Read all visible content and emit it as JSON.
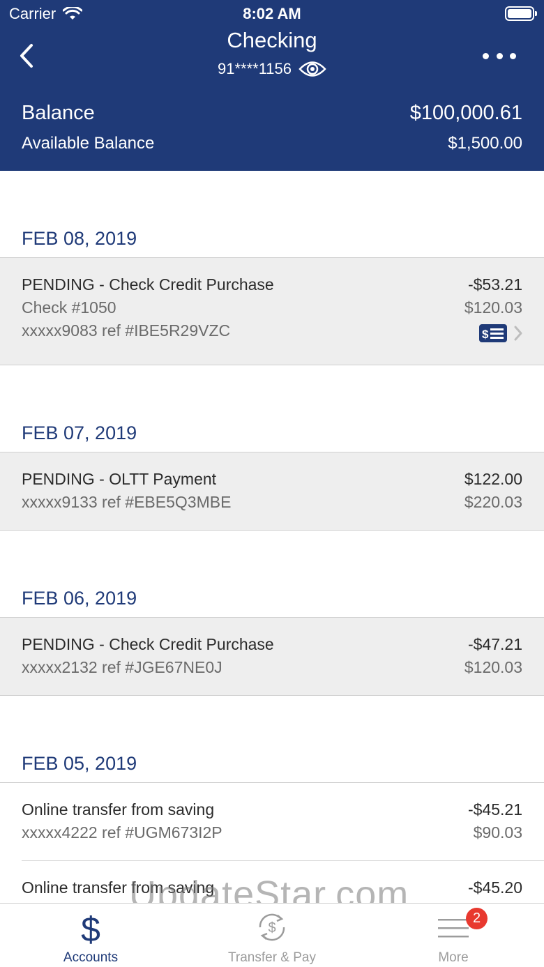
{
  "status_bar": {
    "carrier": "Carrier",
    "time": "8:02 AM"
  },
  "header": {
    "title": "Checking",
    "account_number": "91****1156",
    "balance_label": "Balance",
    "balance_value": "$100,000.61",
    "available_label": "Available Balance",
    "available_value": "$1,500.00"
  },
  "groups": [
    {
      "date": "FEB 08, 2019",
      "transactions": [
        {
          "status": "pending",
          "lines": [
            "PENDING - Check Credit Purchase",
            "Check #1050",
            "xxxxx9083 ref #IBE5R29VZC"
          ],
          "amount": "-$53.21",
          "running_balance": "$120.03",
          "has_check_image": true
        }
      ]
    },
    {
      "date": "FEB 07, 2019",
      "transactions": [
        {
          "status": "pending",
          "lines": [
            "PENDING - OLTT Payment",
            "xxxxx9133 ref #EBE5Q3MBE"
          ],
          "amount": "$122.00",
          "running_balance": "$220.03"
        }
      ]
    },
    {
      "date": "FEB 06, 2019",
      "transactions": [
        {
          "status": "pending",
          "lines": [
            "PENDING - Check Credit Purchase",
            "xxxxx2132 ref #JGE67NE0J"
          ],
          "amount": "-$47.21",
          "running_balance": "$120.03"
        }
      ]
    },
    {
      "date": "FEB 05, 2019",
      "transactions": [
        {
          "status": "posted",
          "lines": [
            "Online transfer from saving",
            "xxxxx4222 ref #UGM673I2P"
          ],
          "amount": "-$45.21",
          "running_balance": "$90.03"
        },
        {
          "status": "posted",
          "lines": [
            "Online transfer from saving"
          ],
          "amount": "-$45.20"
        }
      ]
    }
  ],
  "tabbar": {
    "tabs": [
      {
        "label": "Accounts",
        "icon": "dollar-icon",
        "active": true
      },
      {
        "label": "Transfer & Pay",
        "icon": "transfer-icon",
        "active": false
      },
      {
        "label": "More",
        "icon": "menu-icon",
        "active": false,
        "badge": "2"
      }
    ]
  },
  "watermark": "UpdateStar.com",
  "colors": {
    "header_bg": "#1f3a78",
    "accent": "#1f3a78",
    "pending_bg": "#eeeeee",
    "badge": "#e8392f"
  }
}
